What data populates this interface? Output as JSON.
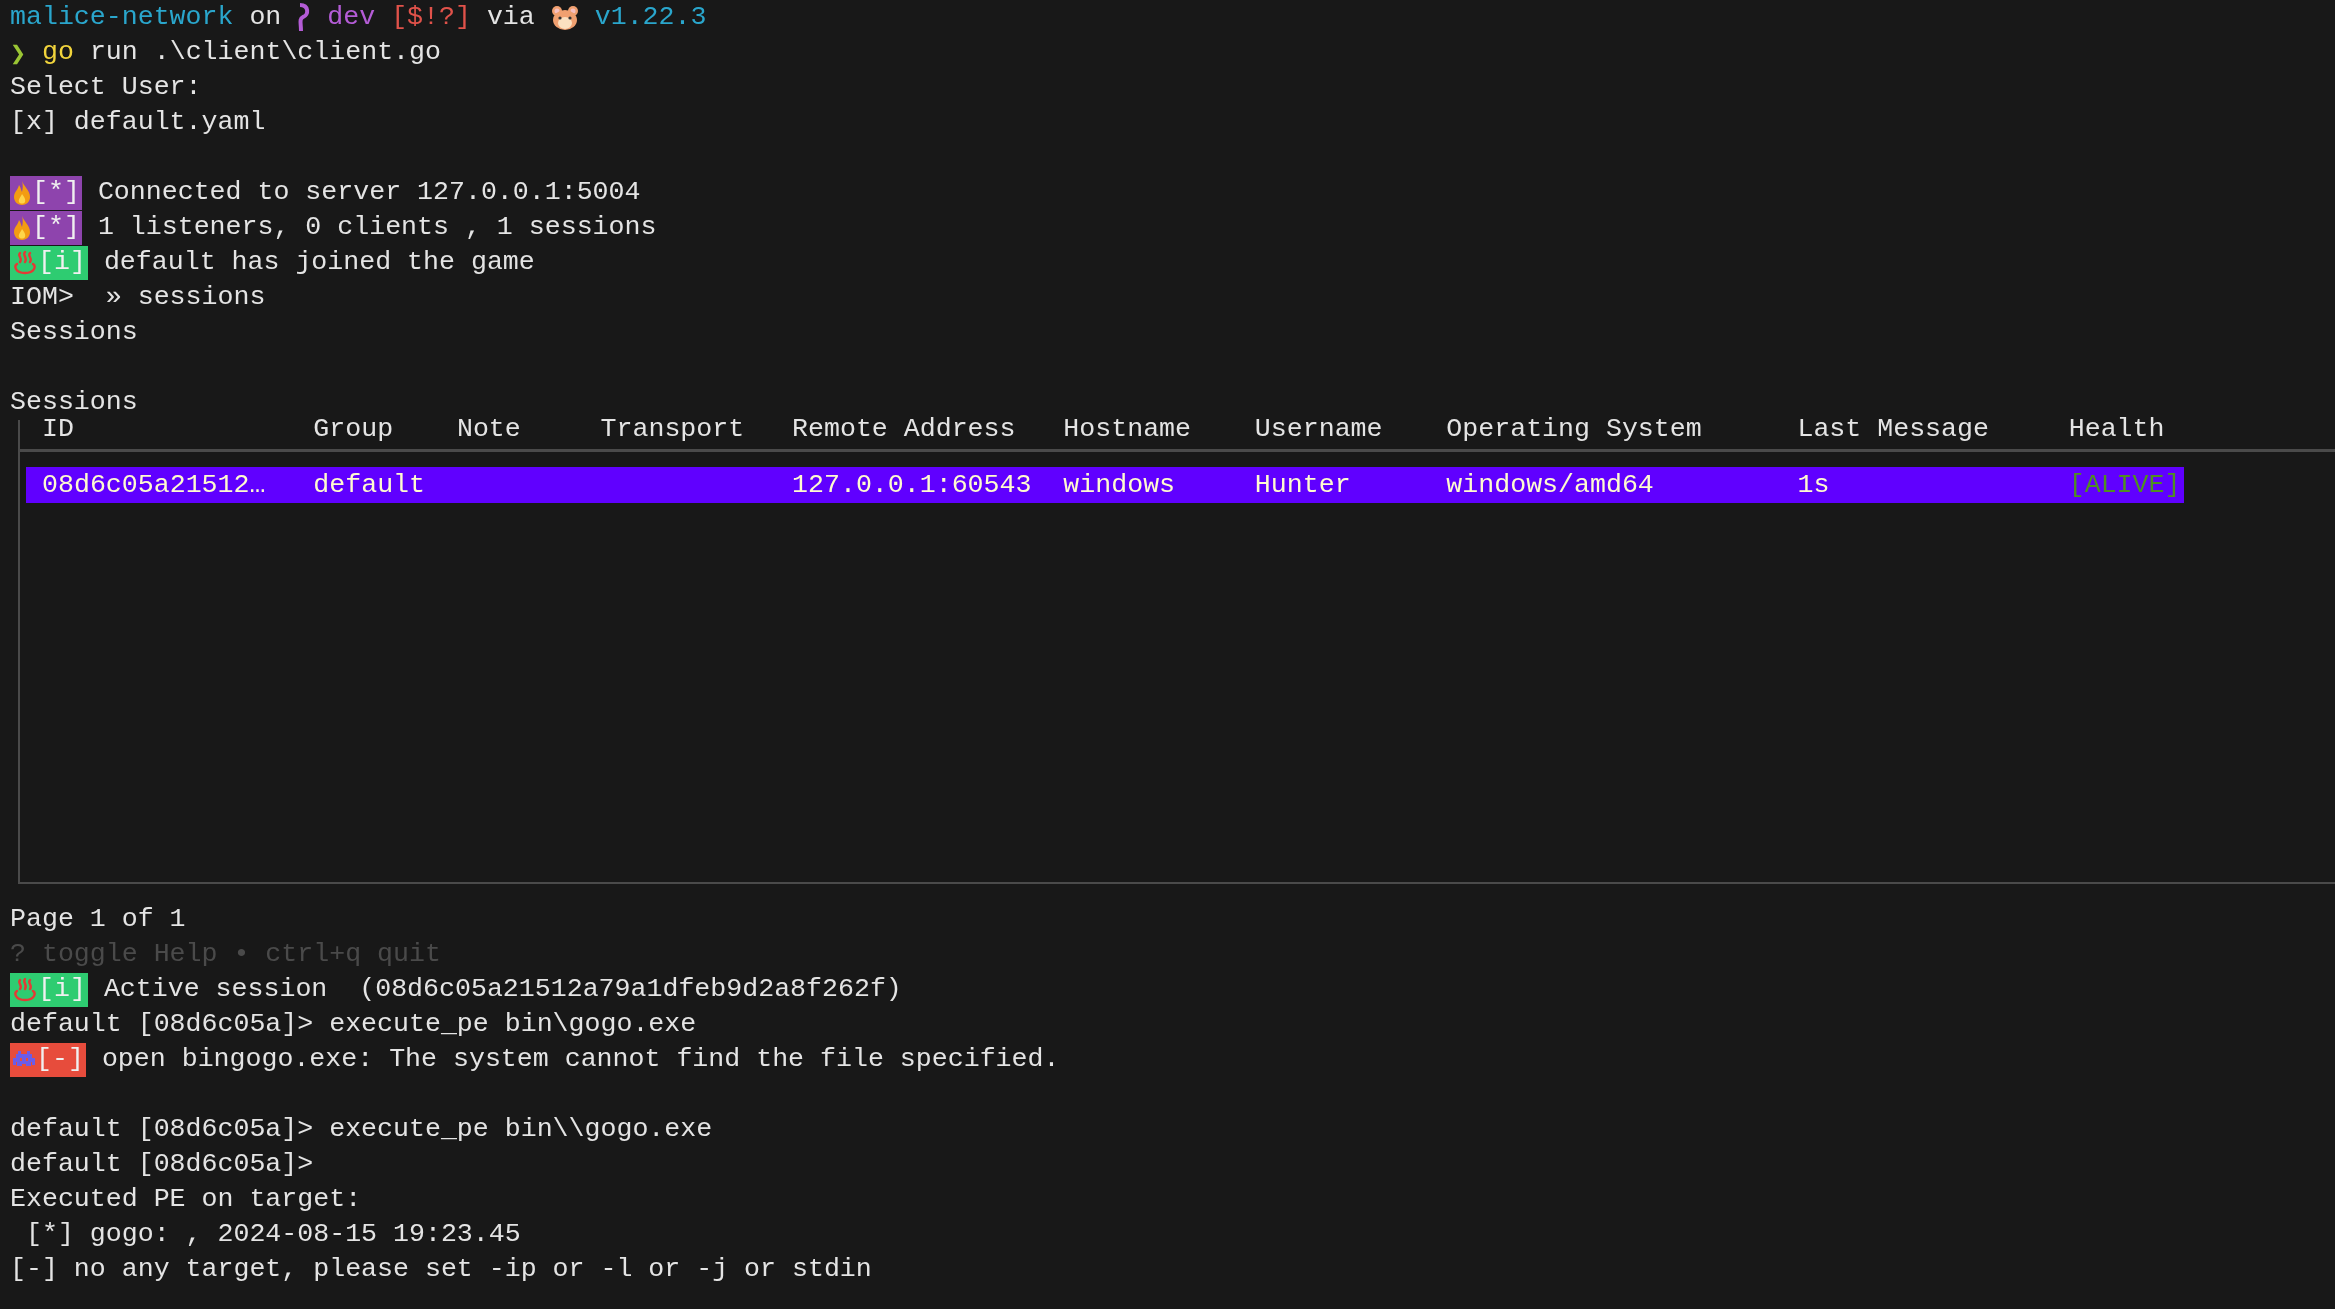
{
  "prompt": {
    "directory": "malice-network",
    "on": "on",
    "branch": "dev",
    "status": "[$!?]",
    "via": "via",
    "version": "v1.22.3"
  },
  "output_before": [
    {
      "kind": "command",
      "symbol": "❯",
      "program": "go",
      "args": "run .\\client\\client.go"
    },
    {
      "kind": "text",
      "text": "Select User:"
    },
    {
      "kind": "text",
      "text": "[x] default.yaml"
    },
    {
      "kind": "blank"
    },
    {
      "kind": "notice",
      "tag": "[*]",
      "text": "Connected to server 127.0.0.1:5004"
    },
    {
      "kind": "notice",
      "tag": "[*]",
      "text": "1 listeners, 0 clients , 1 sessions"
    },
    {
      "kind": "info",
      "tag": "[i]",
      "text": "default has joined the game"
    },
    {
      "kind": "text",
      "text": "IOM>  » sessions"
    },
    {
      "kind": "text",
      "text": "Sessions"
    },
    {
      "kind": "blank"
    }
  ],
  "table": {
    "title": "Sessions",
    "columns": [
      "ID",
      "Group",
      "Note",
      "Transport",
      "Remote Address",
      "Hostname",
      "Username",
      "Operating System",
      "Last Message",
      "Health"
    ],
    "rows": [
      {
        "selected": true,
        "cells": [
          "08d6c05a21512…",
          "default",
          "",
          "",
          "127.0.0.1:60543",
          "windows",
          "Hunter",
          "windows/amd64",
          "1s",
          "[ALIVE]"
        ]
      }
    ],
    "pager": "Page 1 of 1",
    "help": "? toggle Help • ctrl+q quit"
  },
  "output_after": [
    {
      "kind": "info",
      "tag": "[i]",
      "text": "Active session  (08d6c05a21512a79a1dfeb9d2a8f262f)"
    },
    {
      "kind": "text",
      "text": "default [08d6c05a]> execute_pe bin\\gogo.exe"
    },
    {
      "kind": "error",
      "tag": "[-]",
      "text": "open bingogo.exe: The system cannot find the file specified."
    },
    {
      "kind": "blank"
    },
    {
      "kind": "text",
      "text": "default [08d6c05a]> execute_pe bin\\\\gogo.exe"
    },
    {
      "kind": "text",
      "text": "default [08d6c05a]>"
    },
    {
      "kind": "text",
      "text": "Executed PE on target:"
    },
    {
      "kind": "text",
      "text": " [*] gogo: , 2024-08-15 19:23.45"
    },
    {
      "kind": "text",
      "text": "[-] no any target, please set -ip or -l or -j or stdin"
    }
  ]
}
